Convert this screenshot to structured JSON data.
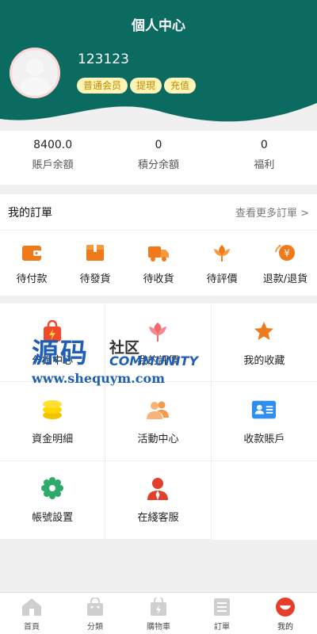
{
  "header": {
    "title": "個人中心",
    "username": "123123",
    "badges": [
      "普通会员",
      "提現",
      "充值"
    ]
  },
  "stats": [
    {
      "value": "8400.0",
      "label": "賬戶余額"
    },
    {
      "value": "0",
      "label": "積分余額"
    },
    {
      "value": "0",
      "label": "福利"
    }
  ],
  "orders": {
    "title": "我的訂單",
    "more": "查看更多訂單 >",
    "items": [
      {
        "label": "待付款",
        "icon": "wallet-icon"
      },
      {
        "label": "待發貨",
        "icon": "package-icon"
      },
      {
        "label": "待收貨",
        "icon": "truck-icon"
      },
      {
        "label": "待評價",
        "icon": "flower-icon"
      },
      {
        "label": "退款/退貨",
        "icon": "refund-icon"
      }
    ]
  },
  "grid": [
    {
      "label": "分銷中心",
      "icon": "shopping-bag-icon"
    },
    {
      "label": "我的評價",
      "icon": "tulip-icon"
    },
    {
      "label": "我的收藏",
      "icon": "star-icon"
    },
    {
      "label": "資金明細",
      "icon": "coins-icon"
    },
    {
      "label": "活動中心",
      "icon": "people-icon"
    },
    {
      "label": "收款賬戶",
      "icon": "id-card-icon"
    },
    {
      "label": "帳號設置",
      "icon": "gear-icon"
    },
    {
      "label": "在綫客服",
      "icon": "customer-service-icon"
    }
  ],
  "watermark": {
    "main": "源码",
    "sub": "社区",
    "en": "COMMUNITY",
    "url": "www.shequym.com"
  },
  "tabbar": [
    {
      "label": "首頁",
      "icon": "home-icon"
    },
    {
      "label": "分類",
      "icon": "category-icon"
    },
    {
      "label": "購物車",
      "icon": "cart-icon"
    },
    {
      "label": "訂單",
      "icon": "order-icon"
    },
    {
      "label": "我的",
      "icon": "profile-icon"
    }
  ],
  "colors": {
    "brand": "#0b6b60",
    "accent_orange": "#f07a1a",
    "badge_bg": "#fff4b8",
    "badge_text": "#c08a00",
    "active_tab": "#e53e2b"
  }
}
